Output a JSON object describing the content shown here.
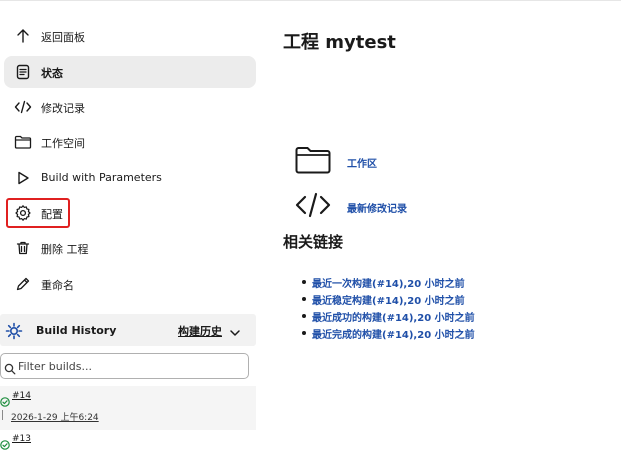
{
  "sidebar": {
    "items": [
      {
        "label": "返回面板",
        "icon": "arrow-up-icon"
      },
      {
        "label": "状态",
        "icon": "document-icon"
      },
      {
        "label": "修改记录",
        "icon": "code-icon"
      },
      {
        "label": "工作空间",
        "icon": "folder-icon"
      },
      {
        "label": "Build with Parameters",
        "icon": "play-icon"
      },
      {
        "label": "配置",
        "icon": "gear-icon"
      },
      {
        "label": "删除 工程",
        "icon": "trash-icon"
      },
      {
        "label": "重命名",
        "icon": "pencil-icon"
      }
    ],
    "active_item": "状态",
    "highlighted_item": "配置",
    "highlight_color": "#e02020"
  },
  "build_history": {
    "title": "Build History",
    "trend_label": "构建历史",
    "filter_placeholder": "Filter builds...",
    "builds": [
      {
        "number": "#14",
        "time": "2026-1-29 上午6:24",
        "status": "success"
      },
      {
        "number": "#13",
        "time": "",
        "status": "success"
      }
    ],
    "success_color": "#1e8e3e"
  },
  "main": {
    "title": "工程 mytest",
    "workspace_link": "工作区",
    "changes_link": "最新修改记录",
    "related_title": "相关链接",
    "related_links": [
      "最近一次构建(#14),20 小时之前",
      "最近稳定构建(#14),20 小时之前",
      "最近成功的构建(#14),20 小时之前",
      "最近完成的构建(#14),20 小时之前"
    ],
    "link_color": "#1f4fa8"
  }
}
